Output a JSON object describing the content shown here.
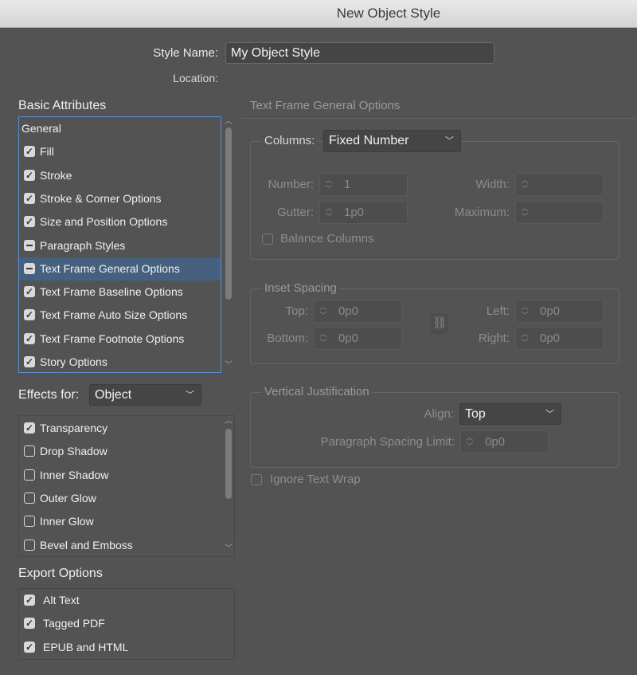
{
  "window": {
    "title": "New Object Style"
  },
  "style_name": {
    "label": "Style Name:",
    "value": "My Object Style"
  },
  "location": {
    "label": "Location:"
  },
  "basic_attributes": {
    "heading": "Basic Attributes",
    "items": [
      {
        "label": "General",
        "state": "none"
      },
      {
        "label": "Fill",
        "state": "checked"
      },
      {
        "label": "Stroke",
        "state": "checked"
      },
      {
        "label": "Stroke & Corner Options",
        "state": "checked"
      },
      {
        "label": "Size and Position Options",
        "state": "checked"
      },
      {
        "label": "Paragraph Styles",
        "state": "mixed"
      },
      {
        "label": "Text Frame General Options",
        "state": "mixed",
        "selected": true
      },
      {
        "label": "Text Frame Baseline Options",
        "state": "checked"
      },
      {
        "label": "Text Frame Auto Size Options",
        "state": "checked"
      },
      {
        "label": "Text Frame Footnote Options",
        "state": "checked"
      },
      {
        "label": "Story Options",
        "state": "checked"
      }
    ]
  },
  "effects": {
    "label": "Effects for:",
    "selected": "Object",
    "items": [
      {
        "label": "Transparency",
        "state": "checked"
      },
      {
        "label": "Drop Shadow",
        "state": "unchecked"
      },
      {
        "label": "Inner Shadow",
        "state": "unchecked"
      },
      {
        "label": "Outer Glow",
        "state": "unchecked"
      },
      {
        "label": "Inner Glow",
        "state": "unchecked"
      },
      {
        "label": "Bevel and Emboss",
        "state": "unchecked"
      }
    ]
  },
  "export_options": {
    "heading": "Export Options",
    "items": [
      {
        "label": "Alt Text",
        "state": "checked"
      },
      {
        "label": "Tagged PDF",
        "state": "checked"
      },
      {
        "label": "EPUB and HTML",
        "state": "checked"
      }
    ]
  },
  "panel": {
    "title": "Text Frame General Options",
    "columns": {
      "label": "Columns:",
      "selected": "Fixed Number",
      "number_label": "Number:",
      "number_value": "1",
      "width_label": "Width:",
      "width_value": "",
      "gutter_label": "Gutter:",
      "gutter_value": "1p0",
      "maximum_label": "Maximum:",
      "maximum_value": "",
      "balance_label": "Balance Columns"
    },
    "inset": {
      "title": "Inset Spacing",
      "top_label": "Top:",
      "top_value": "0p0",
      "bottom_label": "Bottom:",
      "bottom_value": "0p0",
      "left_label": "Left:",
      "left_value": "0p0",
      "right_label": "Right:",
      "right_value": "0p0"
    },
    "vertical": {
      "title": "Vertical Justification",
      "align_label": "Align:",
      "align_value": "Top",
      "spacing_label": "Paragraph Spacing Limit:",
      "spacing_value": "0p0"
    },
    "ignore_wrap_label": "Ignore Text Wrap"
  },
  "colors": {
    "selection": "#46607f",
    "focus_ring": "#5b8fd6",
    "background": "#535353"
  }
}
